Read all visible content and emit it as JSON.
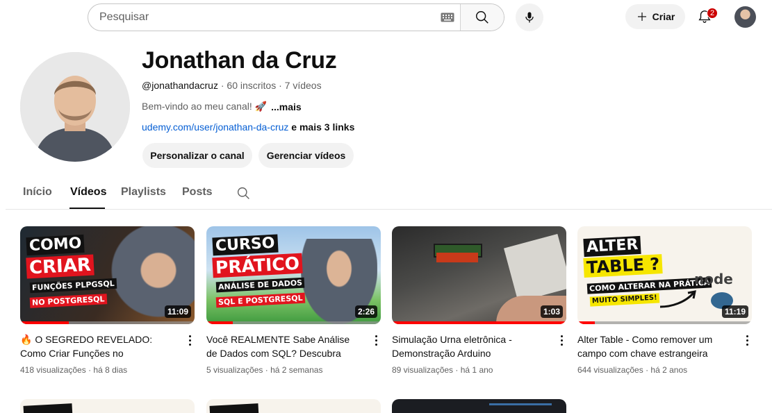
{
  "topbar": {
    "search_placeholder": "Pesquisar",
    "create_label": "Criar",
    "notifications_count": "2"
  },
  "channel": {
    "name": "Jonathan da Cruz",
    "handle": "@jonathandacruz",
    "subscribers": "60 inscritos",
    "video_count": "7 vídeos",
    "separator": "·",
    "description": "Bem-vindo ao meu canal! 🚀",
    "description_more": "...mais",
    "link": "udemy.com/user/jonathan-da-cruz",
    "more_links": "e mais 3 links",
    "customize_button": "Personalizar o canal",
    "manage_button": "Gerenciar vídeos"
  },
  "tabs": [
    "Início",
    "Vídeos",
    "Playlists",
    "Posts"
  ],
  "active_tab": "Vídeos",
  "videos": [
    {
      "title": "🔥 O SEGREDO REVELADO: Como Criar Funções no PostgreSQL em...",
      "views": "418 visualizações",
      "age": "há 8 dias",
      "duration": "11:09",
      "watched_fraction": 0.28,
      "thumb_lines": [
        "COMO",
        "CRIAR",
        "FUNÇÕES PLPGSQL",
        "NO POSTGRESQL"
      ]
    },
    {
      "title": "Você REALMENTE Sabe Análise de Dados com SQL? Descubra Aqui!",
      "views": "5 visualizações",
      "age": "há 2 semanas",
      "duration": "2:26",
      "watched_fraction": 0.15,
      "thumb_lines": [
        "CURSO",
        "PRÁTICO",
        "ANÁLISE DE DADOS",
        "SQL E POSTGRESQL"
      ]
    },
    {
      "title": "Simulação Urna eletrônica - Demonstração Arduino",
      "views": "89 visualizações",
      "age": "há 1 ano",
      "duration": "1:03",
      "watched_fraction": 1.0,
      "thumb_lines": []
    },
    {
      "title": "Alter Table - Como remover um campo com chave estrangeira",
      "views": "644 visualizações",
      "age": "há 2 anos",
      "duration": "11:19",
      "watched_fraction": 0.1,
      "thumb_lines": [
        "ALTER",
        "TABLE ?",
        "COMO ALTERAR NA PRÁTICA",
        "MUITO SIMPLES!",
        "node"
      ]
    }
  ],
  "colors": {
    "accent_red": "#ff0000",
    "link_blue": "#065fd4",
    "thumb_red": "#e1141e",
    "thumb_yellow": "#f6e600"
  }
}
